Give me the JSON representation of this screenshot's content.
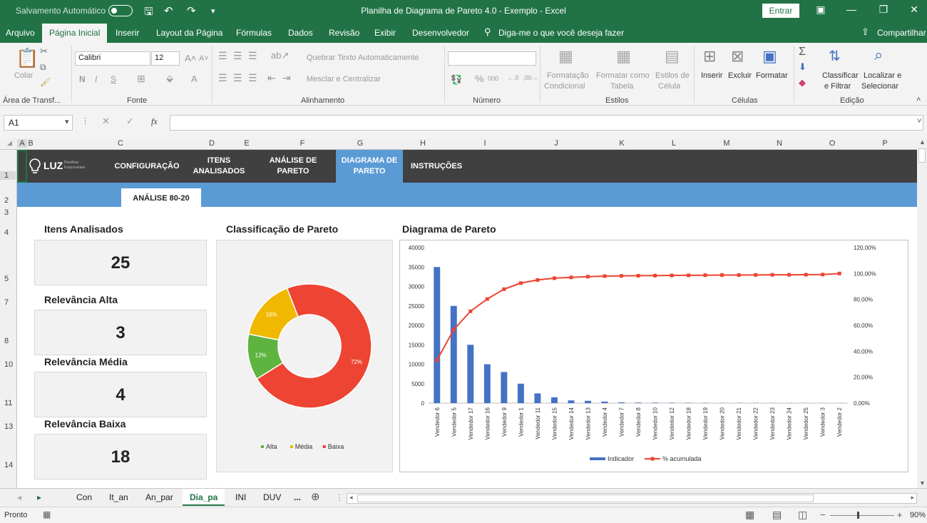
{
  "titlebar": {
    "autosave": "Salvamento Automático",
    "title": "Planilha de Diagrama de Pareto 4.0 - Exemplo  -  Excel",
    "signin": "Entrar"
  },
  "tabs": [
    "Arquivo",
    "Página Inicial",
    "Inserir",
    "Layout da Página",
    "Fórmulas",
    "Dados",
    "Revisão",
    "Exibir",
    "Desenvolvedor"
  ],
  "tell_me": "Diga-me o que você deseja fazer",
  "share": "Compartilhar",
  "ribbon": {
    "paste": "Colar",
    "clipboard": "Área de Transf...",
    "font_name": "Calibri",
    "font_size": "12",
    "font_group": "Fonte",
    "bold": "N",
    "italic": "I",
    "underline": "S",
    "wrap_text": "Quebrar Texto Automaticamente",
    "merge": "Mesclar e Centralizar",
    "alignment": "Alinhamento",
    "percent": "%",
    "thousands": "000",
    "number": "Número",
    "cond_format_1": "Formatação",
    "cond_format_2": "Condicional",
    "format_table_1": "Formatar como",
    "format_table_2": "Tabela",
    "cell_styles_1": "Estilos de",
    "cell_styles_2": "Célula",
    "styles": "Estilos",
    "insert": "Inserir",
    "delete": "Excluir",
    "format": "Formatar",
    "cells": "Células",
    "sort_1": "Classificar",
    "sort_2": "e Filtrar",
    "find_1": "Localizar e",
    "find_2": "Selecionar",
    "editing": "Edição"
  },
  "formula": {
    "namebox": "A1",
    "fx": "fx"
  },
  "columns": [
    "A",
    "B",
    "C",
    "D",
    "E",
    "F",
    "G",
    "H",
    "I",
    "J",
    "K",
    "L",
    "M",
    "N",
    "O",
    "P"
  ],
  "rows": [
    "1",
    "2",
    "3",
    "4",
    "5",
    "7",
    "8",
    "10",
    "11",
    "13",
    "14"
  ],
  "nav": {
    "logo": "LUZ",
    "logo_sub_1": "Planilhas",
    "logo_sub_2": "Empresariais",
    "items": [
      "CONFIGURAÇÃO",
      "ITENS ANALISADOS",
      "ANÁLISE DE PARETO",
      "DIAGRAMA DE PARETO",
      "INSTRUÇÕES"
    ],
    "subtab": "ANÁLISE 80-20"
  },
  "kpis": [
    {
      "label": "Itens Analisados",
      "value": "25"
    },
    {
      "label": "Relevância Alta",
      "value": "3"
    },
    {
      "label": "Relevância Média",
      "value": "4"
    },
    {
      "label": "Relevância Baixa",
      "value": "18"
    }
  ],
  "chart_data": [
    {
      "type": "pie",
      "title": "Classificação de Pareto",
      "donut": true,
      "categories": [
        "Alta",
        "Média",
        "Baixa"
      ],
      "values": [
        12,
        16,
        72
      ],
      "labels": [
        "12%",
        "16%",
        "72%"
      ],
      "colors": [
        "#5fb33f",
        "#f0b800",
        "#ee4433"
      ],
      "legend": "bottom"
    },
    {
      "type": "bar",
      "title": "Diagrama de Pareto",
      "categories": [
        "Vendedor 6",
        "Vendedor 5",
        "Vendedor 17",
        "Vendedor 16",
        "Vendedor 9",
        "Vendedor 1",
        "Vendedor 11",
        "Vendedor 15",
        "Vendedor 14",
        "Vendedor 13",
        "Vendedor 4",
        "Vendedor 7",
        "Vendedor 8",
        "Vendedor 10",
        "Vendedor 12",
        "Vendedor 18",
        "Vendedor 19",
        "Vendedor 20",
        "Vendedor 21",
        "Vendedor 22",
        "Vendedor 23",
        "Vendedor 24",
        "Vendedor 25",
        "Vendedor 3",
        "Vendedor 2"
      ],
      "series": [
        {
          "name": "Indicador",
          "type": "bar",
          "axis": "left",
          "color": "#4472c4",
          "values": [
            35000,
            25000,
            15000,
            10000,
            8000,
            5000,
            2500,
            1500,
            700,
            600,
            400,
            200,
            150,
            120,
            100,
            80,
            70,
            60,
            50,
            40,
            30,
            25,
            20,
            15,
            10
          ]
        },
        {
          "name": "% acumulada",
          "type": "line",
          "axis": "right",
          "color": "#ee4433",
          "values": [
            33.1,
            56.7,
            70.9,
            80.3,
            87.9,
            92.6,
            95.0,
            96.4,
            97.0,
            97.6,
            98.0,
            98.2,
            98.3,
            98.4,
            98.5,
            98.6,
            98.7,
            98.8,
            98.8,
            98.9,
            99.0,
            99.0,
            99.1,
            99.2,
            100.0
          ]
        }
      ],
      "ylim": [
        0,
        40000
      ],
      "yticks": [
        "0",
        "5000",
        "10000",
        "15000",
        "20000",
        "25000",
        "30000",
        "35000",
        "40000"
      ],
      "y2lim": [
        0,
        120
      ],
      "y2ticks": [
        "0,00%",
        "20,00%",
        "40,00%",
        "60,00%",
        "80,00%",
        "100,00%",
        "120,00%"
      ],
      "legend": "bottom"
    }
  ],
  "sheets": [
    "Con",
    "It_an",
    "An_par",
    "Dia_pa",
    "INI",
    "DUV",
    "..."
  ],
  "status": {
    "ready": "Pronto",
    "zoom": "90%"
  }
}
